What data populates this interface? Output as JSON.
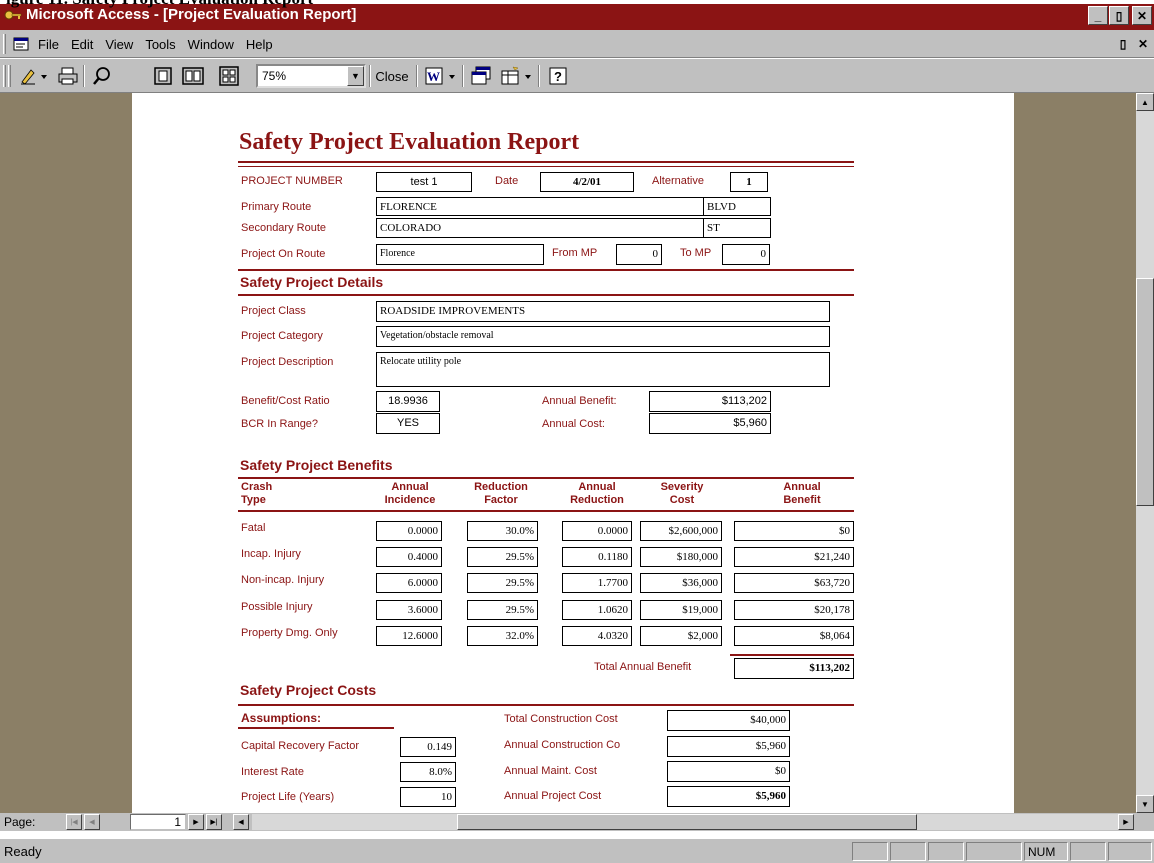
{
  "window": {
    "cut_off_text": "igure 11. Safety Project Evaluation Report",
    "title": "Microsoft Access - [Project Evaluation Report]",
    "minimize": "_",
    "restore": "▯",
    "close": "✕"
  },
  "menu": {
    "items": [
      {
        "label": "File"
      },
      {
        "label": "Edit"
      },
      {
        "label": "View"
      },
      {
        "label": "Tools"
      },
      {
        "label": "Window"
      },
      {
        "label": "Help"
      }
    ],
    "mdi_restore": "▯",
    "mdi_close": "✕"
  },
  "toolbar": {
    "zoom_value": "75%",
    "close_label": "Close"
  },
  "report": {
    "title": "Safety Project Evaluation Report",
    "header": {
      "project_number_label": "PROJECT NUMBER",
      "project_number": "test 1",
      "date_label": "Date",
      "date": "4/2/01",
      "alternative_label": "Alternative",
      "alternative": "1",
      "primary_route_label": "Primary Route",
      "primary_route": "FLORENCE",
      "primary_route_suffix": "BLVD",
      "secondary_route_label": "Secondary Route",
      "secondary_route": "COLORADO",
      "secondary_route_suffix": "ST",
      "on_route_label": "Project On Route",
      "on_route": "Florence",
      "from_mp_label": "From MP",
      "from_mp": "0",
      "to_mp_label": "To MP",
      "to_mp": "0"
    },
    "details": {
      "heading": "Safety Project Details",
      "class_label": "Project Class",
      "class": "ROADSIDE IMPROVEMENTS",
      "category_label": "Project Category",
      "category": "Vegetation/obstacle removal",
      "description_label": "Project Description",
      "description": "Relocate utility pole",
      "bcr_label": "Benefit/Cost Ratio",
      "bcr": "18.9936",
      "bcr_range_label": "BCR In Range?",
      "bcr_range": "YES",
      "annual_benefit_label": "Annual Benefit:",
      "annual_benefit": "$113,202",
      "annual_cost_label": "Annual Cost:",
      "annual_cost": "$5,960"
    },
    "benefits": {
      "heading": "Safety Project Benefits",
      "columns": [
        "Crash Type",
        "Annual Incidence",
        "Reduction Factor",
        "Annual Reduction",
        "Severity Cost",
        "Annual Benefit"
      ],
      "col_line1": [
        "Crash",
        "Annual",
        "Reduction",
        "Annual",
        "Severity",
        "Annual"
      ],
      "col_line2": [
        "Type",
        "Incidence",
        "Factor",
        "Reduction",
        "Cost",
        "Benefit"
      ],
      "rows": [
        {
          "type": "Fatal",
          "incidence": "0.0000",
          "factor": "30.0%",
          "reduction": "0.0000",
          "cost": "$2,600,000",
          "benefit": "$0"
        },
        {
          "type": "Incap. Injury",
          "incidence": "0.4000",
          "factor": "29.5%",
          "reduction": "0.1180",
          "cost": "$180,000",
          "benefit": "$21,240"
        },
        {
          "type": "Non-incap. Injury",
          "incidence": "6.0000",
          "factor": "29.5%",
          "reduction": "1.7700",
          "cost": "$36,000",
          "benefit": "$63,720"
        },
        {
          "type": "Possible Injury",
          "incidence": "3.6000",
          "factor": "29.5%",
          "reduction": "1.0620",
          "cost": "$19,000",
          "benefit": "$20,178"
        },
        {
          "type": "Property Dmg. Only",
          "incidence": "12.6000",
          "factor": "32.0%",
          "reduction": "4.0320",
          "cost": "$2,000",
          "benefit": "$8,064"
        }
      ],
      "total_label": "Total Annual Benefit",
      "total": "$113,202"
    },
    "costs": {
      "heading": "Safety Project Costs",
      "assumptions_label": "Assumptions:",
      "crf_label": "Capital Recovery Factor",
      "crf": "0.149",
      "interest_label": "Interest Rate",
      "interest": "8.0%",
      "life_label": "Project Life (Years)",
      "life": "10",
      "total_construction_label": "Total Construction Cost",
      "total_construction": "$40,000",
      "annual_construction_label": "Annual Construction Co",
      "annual_construction": "$5,960",
      "annual_maint_label": "Annual Maint. Cost",
      "annual_maint": "$0",
      "annual_project_label": "Annual Project Cost",
      "annual_project": "$5,960"
    }
  },
  "navigation": {
    "page_label": "Page:",
    "page_number": "1"
  },
  "status": {
    "text": "Ready",
    "num": "NUM"
  }
}
